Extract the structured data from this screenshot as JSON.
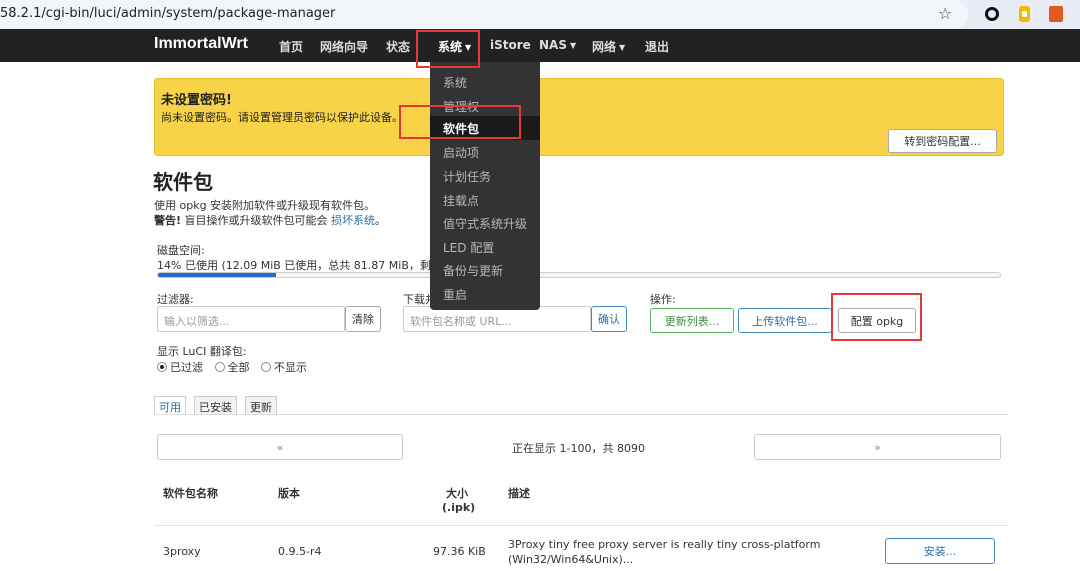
{
  "browser": {
    "url": "58.2.1/cgi-bin/luci/admin/system/package-manager"
  },
  "nav": {
    "brand": "ImmortalWrt",
    "items": [
      "首页",
      "网络向导",
      "状态",
      "系统",
      "iStore",
      "NAS",
      "网络",
      "退出"
    ]
  },
  "dropdown": {
    "items": [
      "系统",
      "管理权",
      "软件包",
      "启动项",
      "计划任务",
      "挂载点",
      "值守式系统升级",
      "LED 配置",
      "备份与更新",
      "重启"
    ]
  },
  "alert": {
    "title": "未设置密码!",
    "text": "尚未设置密码。请设置管理员密码以保护此设备。",
    "button": "转到密码配置..."
  },
  "page": {
    "title": "软件包",
    "desc1": "使用 opkg 安装附加软件或升级现有软件包。",
    "warn_label": "警告!",
    "warn_text": "盲目操作或升级软件包可能会",
    "warn_link": "损坏系统",
    "warn_end": "。"
  },
  "disk": {
    "label": "磁盘空间:",
    "text": "14% 已使用 (12.09 MiB 已使用，总共 81.87 MiB，剩",
    "percent": 14
  },
  "filter": {
    "label": "过滤器:",
    "placeholder": "输入以筛选...",
    "clear": "清除"
  },
  "download": {
    "label": "下载并",
    "placeholder": "软件包名称或 URL...",
    "confirm": "确认"
  },
  "actions": {
    "label": "操作:",
    "update": "更新列表...",
    "upload": "上传软件包...",
    "config": "配置 opkg"
  },
  "luci": {
    "label": "显示 LuCI 翻译包:",
    "options": [
      "已过滤",
      "全部",
      "不显示"
    ]
  },
  "tabs": [
    "可用",
    "已安装",
    "更新"
  ],
  "pager": {
    "prev": "«",
    "next": "»",
    "text": "正在显示 1-100，共 8090"
  },
  "table": {
    "headers": {
      "name": "软件包名称",
      "version": "版本",
      "size": "大小",
      "size_unit": "(.ipk)",
      "desc": "描述"
    },
    "rows": [
      {
        "name": "3proxy",
        "version": "0.9.5-r4",
        "size": "97.36 KiB",
        "desc1": "3Proxy tiny free proxy server is really tiny cross-platform",
        "desc2": "(Win32/Win64&Unix)...",
        "action": "安装..."
      }
    ]
  }
}
